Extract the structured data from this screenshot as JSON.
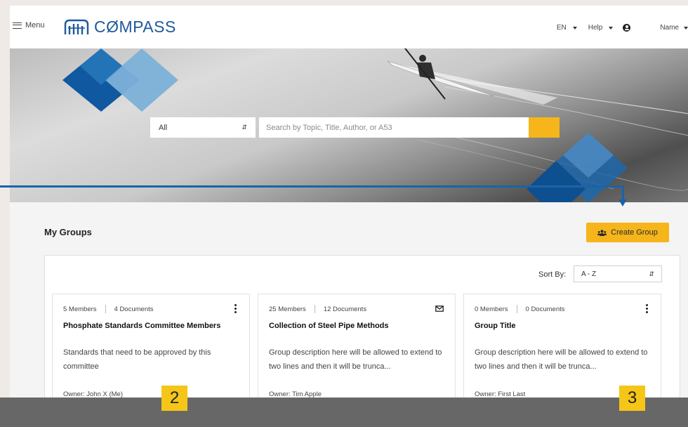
{
  "header": {
    "menu_label": "Menu",
    "logo_text": "CØMPASS",
    "language": "EN",
    "help_label": "Help",
    "user_name": "Name"
  },
  "search": {
    "scope": "All",
    "placeholder": "Search by Topic, Title, Author, or A53"
  },
  "groups": {
    "title": "My Groups",
    "create_label": "Create Group",
    "sort_label": "Sort By:",
    "sort_value": "A - Z",
    "cards": [
      {
        "members": "5 Members",
        "documents": "4 Documents",
        "title": "Phosphate Standards Committee Members",
        "description": "Standards that need to be approved by this committee",
        "owner": "Owner: John X (Me)"
      },
      {
        "members": "25 Members",
        "documents": "12 Documents",
        "title": "Collection of Steel Pipe Methods",
        "description": "Group description here will be allowed to extend to two lines and then it will be trunca...",
        "owner": "Owner: Tim Apple"
      },
      {
        "members": "0 Members",
        "documents": "0 Documents",
        "title": "Group Title",
        "description": "Group description here will be allowed to extend to two lines and then it will be trunca...",
        "owner": "Owner: First Last"
      }
    ]
  },
  "callouts": {
    "badge_left": "2",
    "badge_right": "3"
  },
  "colors": {
    "brand_blue": "#1d5a9c",
    "accent_yellow": "#f5b51b",
    "callout_blue": "#1a63a8",
    "badge_yellow": "#f5c518"
  }
}
